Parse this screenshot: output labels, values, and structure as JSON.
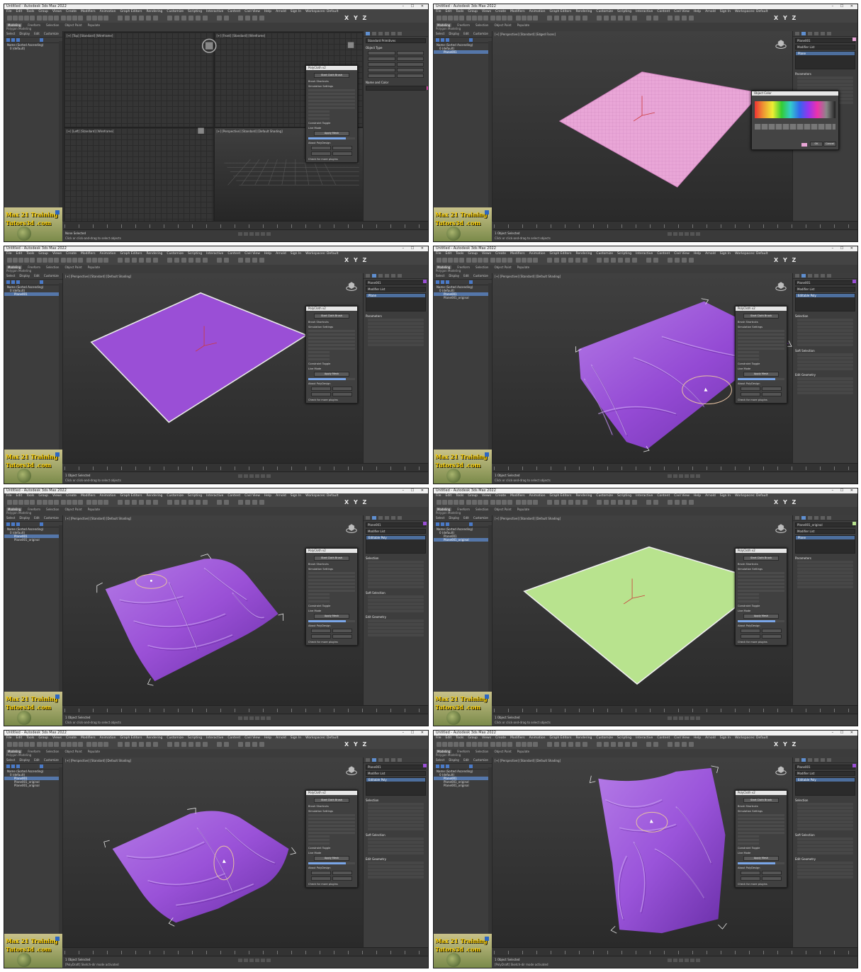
{
  "window_title": "Untitled - Autodesk 3ds Max 2022",
  "menu": [
    "File",
    "Edit",
    "Tools",
    "Group",
    "Views",
    "Create",
    "Modifiers",
    "Animation",
    "Graph Editors",
    "Rendering",
    "Customize",
    "Scripting",
    "Interactive",
    "Content",
    "Civil View",
    "Help",
    "Arnold",
    "Sign In",
    "Workspaces: Default"
  ],
  "axis_letters": "X Y Z",
  "ribbon": {
    "tabs": [
      "Modeling",
      "Freeform",
      "Selection",
      "Object Paint",
      "Populate"
    ],
    "sub": "Polygon Modeling"
  },
  "explorer": {
    "tabs": [
      "Select",
      "Display",
      "Edit",
      "Customize"
    ]
  },
  "logo": {
    "line1": "Max 21 Training",
    "line2": "Tutors3d .com"
  },
  "colors": {
    "pink_plane": "#e9a6d7",
    "purple_cloth": "#9a4fd6",
    "green_plane": "#b8e38e"
  },
  "panels": [
    {
      "layout": "quad",
      "viewport_labels": [
        "[+] [Top] [Standard] [Wireframe]",
        "[+] [Front] [Standard] [Wireframe]",
        "[+] [Left] [Standard] [Wireframe]",
        "[+] [Perspective] [Standard] [Default Shading]"
      ],
      "explorer_rows": [
        "Name (Sorted Ascending)",
        "0 (default)"
      ],
      "selected_rows": [],
      "cmd": {
        "header": "Standard Primitives",
        "sections": [
          "Object Type",
          "Name and Color"
        ]
      },
      "float_title": "PolyCloth v2",
      "status_line1": "None Selected",
      "status_line2": "Click or click-and-drag to select objects"
    },
    {
      "layout": "single",
      "viewport_label": "[+] [Perspective] [Standard] [Edged Faces]",
      "explorer_rows": [
        "Name (Sorted Ascending)",
        "0 (default)",
        "Plane001"
      ],
      "selected_rows": [
        2
      ],
      "cmd": {
        "object_name": "Plane001",
        "modifier_list": "Modifier List",
        "stack_item": "Plane",
        "sections": [
          "Parameters"
        ]
      },
      "picker": {
        "title": "Object Color",
        "btn_ok": "OK",
        "btn_cancel": "Cancel"
      },
      "status_line1": "1 Object Selected",
      "status_line2": "Click or click-and-drag to select objects"
    },
    {
      "layout": "single",
      "viewport_label": "[+] [Perspective] [Standard] [Default Shading]",
      "explorer_rows": [
        "Name (Sorted Ascending)",
        "0 (default)",
        "Plane001"
      ],
      "selected_rows": [
        2
      ],
      "cmd": {
        "object_name": "Plane001",
        "modifier_list": "Modifier List",
        "stack_item": "Plane",
        "sections": [
          "Parameters"
        ]
      },
      "float_title": "PolyCloth v2",
      "status_line1": "1 Object Selected",
      "status_line2": "Click or click-and-drag to select objects"
    },
    {
      "layout": "single",
      "viewport_label": "[+] [Perspective] [Standard] [Default Shading]",
      "explorer_rows": [
        "Name (Sorted Ascending)",
        "0 (default)",
        "Plane001",
        "Plane001_original"
      ],
      "selected_rows": [
        2
      ],
      "cmd": {
        "object_name": "Plane001",
        "modifier_list": "Modifier List",
        "stack_item": "Editable Poly",
        "sections": [
          "Selection",
          "Soft Selection",
          "Edit Geometry"
        ]
      },
      "float_title": "PolyCloth v2",
      "status_line1": "1 Object Selected",
      "status_line2": "Click or click-and-drag to select objects"
    },
    {
      "layout": "single",
      "viewport_label": "[+] [Perspective] [Standard] [Default Shading]",
      "explorer_rows": [
        "Name (Sorted Ascending)",
        "0 (default)",
        "Plane001",
        "Plane001_original"
      ],
      "selected_rows": [
        2
      ],
      "cmd": {
        "object_name": "Plane001",
        "modifier_list": "Modifier List",
        "stack_item": "Editable Poly",
        "sections": [
          "Selection",
          "Soft Selection",
          "Edit Geometry"
        ]
      },
      "float_title": "PolyCloth v2",
      "status_line1": "1 Object Selected",
      "status_line2": "Click or click-and-drag to select objects"
    },
    {
      "layout": "single",
      "viewport_label": "[+] [Perspective] [Standard] [Default Shading]",
      "explorer_rows": [
        "Name (Sorted Ascending)",
        "0 (default)",
        "Plane001",
        "Plane001_original"
      ],
      "selected_rows": [
        3
      ],
      "cmd": {
        "object_name": "Plane001_original",
        "modifier_list": "Modifier List",
        "stack_item": "Plane",
        "sections": [
          "Parameters"
        ]
      },
      "float_title": "PolyCloth v2",
      "status_line1": "1 Object Selected",
      "status_line2": "Click or click-and-drag to select objects"
    },
    {
      "layout": "single",
      "viewport_label": "[+] [Perspective] [Standard] [Default Shading]",
      "explorer_rows": [
        "Name (Sorted Ascending)",
        "0 (default)",
        "Plane001",
        "Plane001_original",
        "Plane001_original"
      ],
      "selected_rows": [
        2
      ],
      "cmd": {
        "object_name": "Plane001",
        "modifier_list": "Modifier List",
        "stack_item": "Editable Poly",
        "sections": [
          "Selection",
          "Soft Selection",
          "Edit Geometry"
        ]
      },
      "float_title": "PolyCloth v2",
      "status_line1": "1 Object Selected",
      "status_line2": "[PolyDraft] Sketch-dir mode activated"
    },
    {
      "layout": "single",
      "viewport_label": "[+] [Perspective] [Standard] [Default Shading]",
      "explorer_rows": [
        "Name (Sorted Ascending)",
        "0 (default)",
        "Plane001",
        "Plane001_original",
        "Plane001_original"
      ],
      "selected_rows": [
        2
      ],
      "cmd": {
        "object_name": "Plane001",
        "modifier_list": "Modifier List",
        "stack_item": "Editable Poly",
        "sections": [
          "Selection",
          "Soft Selection",
          "Edit Geometry"
        ]
      },
      "float_title": "PolyCloth v2",
      "status_line1": "1 Object Selected",
      "status_line2": "[PolyDraft] Sketch-dir mode activated"
    }
  ],
  "float_common": {
    "btn_start": "Start Cloth Brush",
    "brush_shortcuts": "Brush Shortcuts",
    "simulation_settings": "Simulation Settings",
    "constraint_toggle": "Constraint Toggle",
    "live_mode": "Live Mode",
    "btn_apply": "Apply Mesh",
    "about": "About PolyDesign",
    "check": "Check for more plugins"
  }
}
